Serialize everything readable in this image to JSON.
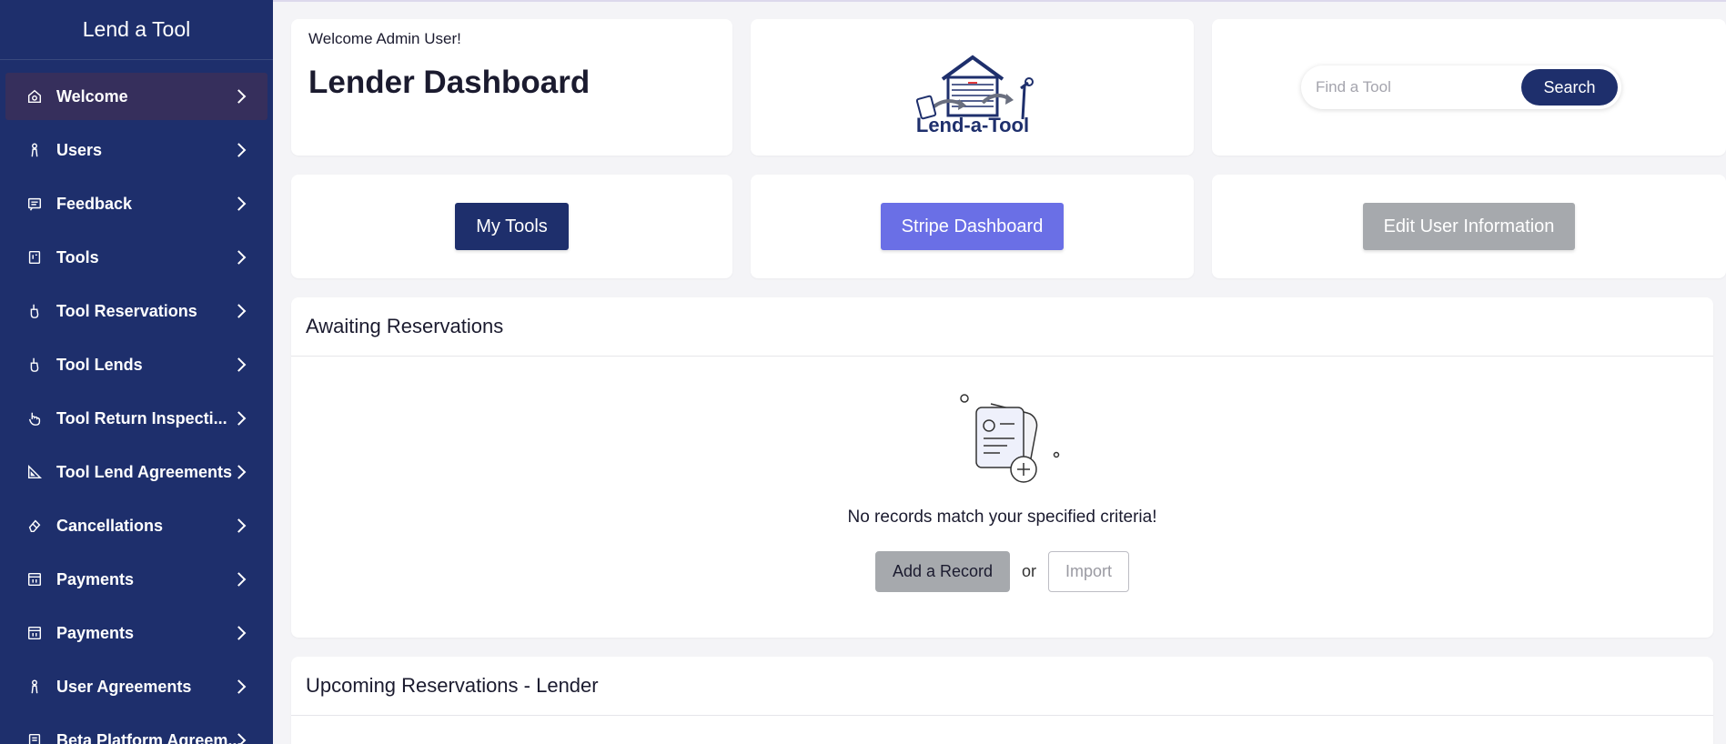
{
  "sidebar": {
    "brand": "Lend a Tool",
    "items": [
      {
        "label": "Welcome",
        "icon": "home-gear-icon",
        "active": true
      },
      {
        "label": "Users",
        "icon": "person-icon"
      },
      {
        "label": "Feedback",
        "icon": "feedback-icon"
      },
      {
        "label": "Tools",
        "icon": "tool-box-icon"
      },
      {
        "label": "Tool Reservations",
        "icon": "hand-tool-icon"
      },
      {
        "label": "Tool Lends",
        "icon": "hand-tool-icon"
      },
      {
        "label": "Tool Return Inspecti...",
        "icon": "hand-pointer-icon"
      },
      {
        "label": "Tool Lend Agreements",
        "icon": "ruler-triangle-icon"
      },
      {
        "label": "Cancellations",
        "icon": "eraser-icon"
      },
      {
        "label": "Payments",
        "icon": "receipt-icon"
      },
      {
        "label": "Payments",
        "icon": "receipt-icon"
      },
      {
        "label": "User Agreements",
        "icon": "person-icon"
      },
      {
        "label": "Beta Platform Agreem...",
        "icon": "document-icon"
      }
    ]
  },
  "header": {
    "welcome": "Welcome Admin User!",
    "title": "Lender Dashboard",
    "logo_text": "Lend-a-Tool"
  },
  "search": {
    "placeholder": "Find a Tool",
    "button": "Search"
  },
  "actions": {
    "my_tools": "My Tools",
    "stripe": "Stripe Dashboard",
    "edit_user": "Edit User Information"
  },
  "panels": {
    "awaiting": {
      "title": "Awaiting Reservations",
      "empty_text": "No records match your specified criteria!",
      "add_label": "Add a Record",
      "or_label": "or",
      "import_label": "Import"
    },
    "upcoming": {
      "title": "Upcoming Reservations - Lender"
    }
  },
  "colors": {
    "sidebar_bg": "#1e2f6c",
    "active_item": "#362f5c",
    "primary": "#1e2f6c",
    "stripe": "#6a6fe6",
    "muted": "#a6a9ad"
  }
}
